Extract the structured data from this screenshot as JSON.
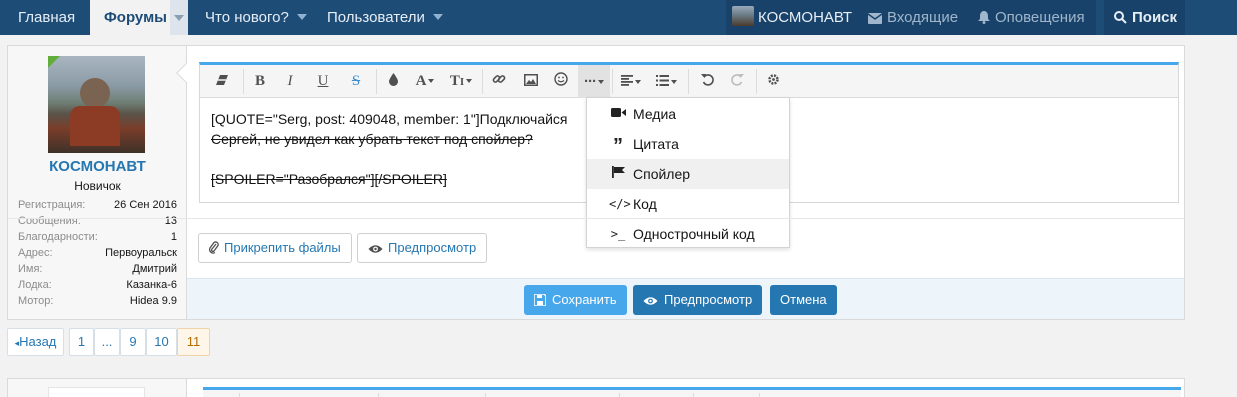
{
  "nav": {
    "home": "Главная",
    "forums": "Форумы",
    "whats_new": "Что нового?",
    "users": "Пользователи",
    "account_name": "КОСМОНАВТ",
    "inbox": "Входящие",
    "alerts": "Оповещения",
    "search": "Поиск"
  },
  "user": {
    "name": "КОСМОНАВТ",
    "rank": "Новичок",
    "stats": [
      {
        "key": "Регистрация:",
        "value": "26 Сен 2016"
      },
      {
        "key": "Сообщения:",
        "value": "13"
      },
      {
        "key": "Благодарности:",
        "value": "1"
      },
      {
        "key": "Адрес:",
        "value": "Первоуральск"
      },
      {
        "key": "Имя:",
        "value": "Дмитрий"
      },
      {
        "key": "Лодка:",
        "value": "Казанка-6"
      },
      {
        "key": "Мотор:",
        "value": "Hidea 9.9"
      }
    ]
  },
  "editor": {
    "line1": "[QUOTE=\"Serg, post: 409048, member: 1\"]Подключайся",
    "line2": "Сергей, не увидел как убрать текст под спойлер?",
    "line3": "[SPOILER=\"Разобрался\"][/SPOILER]"
  },
  "insert_menu": {
    "items": [
      {
        "label": "Медиа",
        "icon": "video-camera-icon"
      },
      {
        "label": "Цитата",
        "icon": "quote-icon"
      },
      {
        "label": "Спойлер",
        "icon": "flag-icon"
      },
      {
        "label": "Код",
        "icon": "code-icon"
      },
      {
        "label": "Однострочный код",
        "icon": "terminal-icon"
      }
    ]
  },
  "actions": {
    "attach": "Прикрепить файлы",
    "preview_light": "Предпросмотр",
    "save": "Сохранить",
    "preview": "Предпросмотр",
    "cancel": "Отмена"
  },
  "pagination": {
    "prev": "Назад",
    "pages": [
      "1",
      "...",
      "9",
      "10",
      "11"
    ],
    "current": "11"
  },
  "colors": {
    "nav_bg": "#1d4c77",
    "accent": "#47a7eb",
    "link": "#2577b1"
  }
}
